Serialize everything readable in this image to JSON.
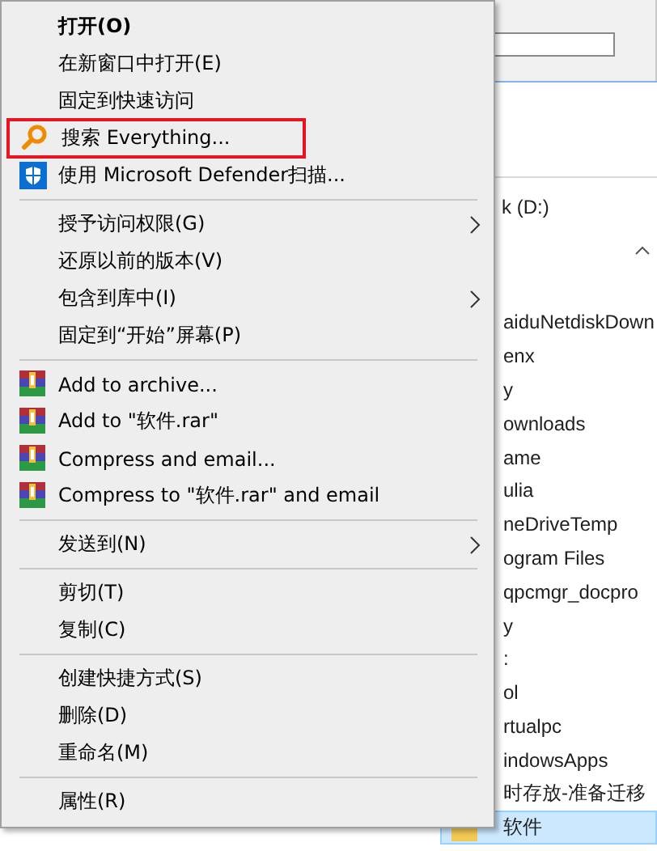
{
  "explorer": {
    "drive": "k (D:)",
    "folders": [
      {
        "name": "aiduNetdiskDown",
        "selected": false
      },
      {
        "name": "enx",
        "selected": false
      },
      {
        "name": "y",
        "selected": false
      },
      {
        "name": "ownloads",
        "selected": false
      },
      {
        "name": "ame",
        "selected": false
      },
      {
        "name": "ulia",
        "selected": false
      },
      {
        "name": "neDriveTemp",
        "selected": false
      },
      {
        "name": "ogram Files",
        "selected": false
      },
      {
        "name": "qpcmgr_docpro",
        "selected": false
      },
      {
        "name": "y",
        "selected": false
      },
      {
        "name": ":",
        "selected": false
      },
      {
        "name": "ol",
        "selected": false
      },
      {
        "name": "rtualpc",
        "selected": false
      },
      {
        "name": "indowsApps",
        "selected": false
      },
      {
        "name": "时存放-准备迁移",
        "selected": false
      },
      {
        "name": "软件",
        "selected": true,
        "folder_icon": true
      }
    ]
  },
  "menu": {
    "items": [
      {
        "kind": "plain",
        "label": "打开(O)",
        "bold": true
      },
      {
        "kind": "plain",
        "label": "在新窗口中打开(E)"
      },
      {
        "kind": "plain",
        "label": "固定到快速访问"
      },
      {
        "kind": "search",
        "label": "搜索 Everything...",
        "outlined": true
      },
      {
        "kind": "shield",
        "label": "使用 Microsoft Defender扫描..."
      },
      {
        "kind": "separator"
      },
      {
        "kind": "plain",
        "label": "授予访问权限(G)",
        "submenu": true
      },
      {
        "kind": "plain",
        "label": "还原以前的版本(V)"
      },
      {
        "kind": "plain",
        "label": "包含到库中(I)",
        "submenu": true
      },
      {
        "kind": "plain",
        "label": "固定到“开始”屏幕(P)"
      },
      {
        "kind": "separator"
      },
      {
        "kind": "archive",
        "label": "Add to archive..."
      },
      {
        "kind": "archive",
        "label": "Add to \"软件.rar\""
      },
      {
        "kind": "archive",
        "label": "Compress and email..."
      },
      {
        "kind": "archive",
        "label": "Compress to \"软件.rar\" and email"
      },
      {
        "kind": "separator"
      },
      {
        "kind": "plain",
        "label": "发送到(N)",
        "submenu": true
      },
      {
        "kind": "separator"
      },
      {
        "kind": "plain",
        "label": "剪切(T)"
      },
      {
        "kind": "plain",
        "label": "复制(C)"
      },
      {
        "kind": "separator"
      },
      {
        "kind": "plain",
        "label": "创建快捷方式(S)"
      },
      {
        "kind": "plain",
        "label": "删除(D)"
      },
      {
        "kind": "plain",
        "label": "重命名(M)"
      },
      {
        "kind": "separator"
      },
      {
        "kind": "plain",
        "label": "属性(R)"
      }
    ]
  }
}
